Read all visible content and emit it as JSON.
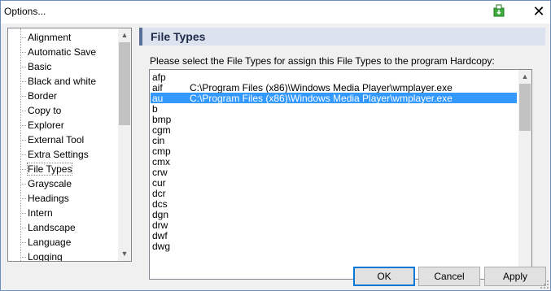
{
  "window": {
    "title": "Options..."
  },
  "tree": {
    "items": [
      {
        "label": "Alignment"
      },
      {
        "label": "Automatic Save"
      },
      {
        "label": "Basic"
      },
      {
        "label": "Black and white"
      },
      {
        "label": "Border"
      },
      {
        "label": "Copy to"
      },
      {
        "label": "Explorer"
      },
      {
        "label": "External Tool"
      },
      {
        "label": "Extra Settings"
      },
      {
        "label": "File Types",
        "selected": true
      },
      {
        "label": "Grayscale"
      },
      {
        "label": "Headings"
      },
      {
        "label": "Intern"
      },
      {
        "label": "Landscape"
      },
      {
        "label": "Language"
      },
      {
        "label": "Logging"
      }
    ]
  },
  "panel": {
    "title": "File Types",
    "prompt": "Please select the File Types for assign this File Types to the program Hardcopy:"
  },
  "filetypes": {
    "rows": [
      {
        "ext": "afp",
        "path": ""
      },
      {
        "ext": "aif",
        "path": "C:\\Program Files (x86)\\Windows Media Player\\wmplayer.exe"
      },
      {
        "ext": "au",
        "path": "C:\\Program Files (x86)\\Windows Media Player\\wmplayer.exe",
        "selected": true
      },
      {
        "ext": "b",
        "path": ""
      },
      {
        "ext": "bmp",
        "path": ""
      },
      {
        "ext": "cgm",
        "path": ""
      },
      {
        "ext": "cin",
        "path": ""
      },
      {
        "ext": "cmp",
        "path": ""
      },
      {
        "ext": "cmx",
        "path": ""
      },
      {
        "ext": "crw",
        "path": ""
      },
      {
        "ext": "cur",
        "path": ""
      },
      {
        "ext": "dcr",
        "path": ""
      },
      {
        "ext": "dcs",
        "path": ""
      },
      {
        "ext": "dgn",
        "path": ""
      },
      {
        "ext": "drw",
        "path": ""
      },
      {
        "ext": "dwf",
        "path": ""
      },
      {
        "ext": "dwg",
        "path": ""
      }
    ]
  },
  "buttons": {
    "ok": "OK",
    "cancel": "Cancel",
    "apply": "Apply"
  },
  "icons": {
    "close": "close-icon",
    "pin": "pin-icon",
    "scroll_up": "chevron-up-icon",
    "scroll_down": "chevron-down-icon",
    "grip": "resize-grip-icon"
  },
  "colors": {
    "selection": "#3399ff",
    "panel_header": "#dde3ee",
    "panel_title": "#1e2b49",
    "default_button_border": "#0078d7"
  }
}
